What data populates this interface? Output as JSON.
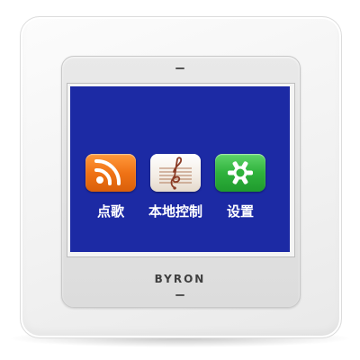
{
  "screen": {
    "background_color": "#1c2aa4",
    "apps": [
      {
        "label": "点歌",
        "icon": "rss-icon",
        "color": "#f07316"
      },
      {
        "label": "本地控制",
        "icon": "music-score-icon",
        "color": "#f3ece4"
      },
      {
        "label": "设置",
        "icon": "settings-icon",
        "color": "#2fb23c"
      }
    ]
  },
  "device": {
    "brand": "BYRON"
  }
}
